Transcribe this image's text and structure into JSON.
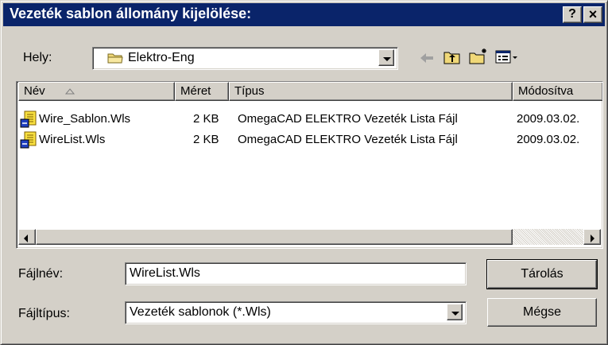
{
  "window": {
    "title": "Vezeték sablon állomány kijelölése:",
    "help_button": "?",
    "close_button": "×"
  },
  "location": {
    "label": "Hely:",
    "value": "Elektro-Eng",
    "toolbar_icons": [
      "back-arrow-icon",
      "up-one-level-icon",
      "new-folder-icon",
      "view-menu-icon"
    ]
  },
  "file_list": {
    "columns": [
      "Név",
      "Méret",
      "Típus",
      "Módosítva"
    ],
    "sort_column": "Név",
    "files": [
      {
        "name": "Wire_Sablon.Wls",
        "size": "2 KB",
        "type": "OmegaCAD ELEKTRO Vezeték Lista Fájl",
        "modified": "2009.03.02."
      },
      {
        "name": "WireList.Wls",
        "size": "2 KB",
        "type": "OmegaCAD ELEKTRO Vezeték Lista Fájl",
        "modified": "2009.03.02."
      }
    ]
  },
  "filename": {
    "label": "Fájlnév:",
    "value": "WireList.Wls"
  },
  "filetype": {
    "label": "Fájltípus:",
    "value": "Vezeték sablonok (*.Wls)"
  },
  "buttons": {
    "save": "Tárolás",
    "cancel": "Mégse"
  },
  "colors": {
    "titlebar": "#0a246a",
    "face": "#d4d0c8"
  }
}
